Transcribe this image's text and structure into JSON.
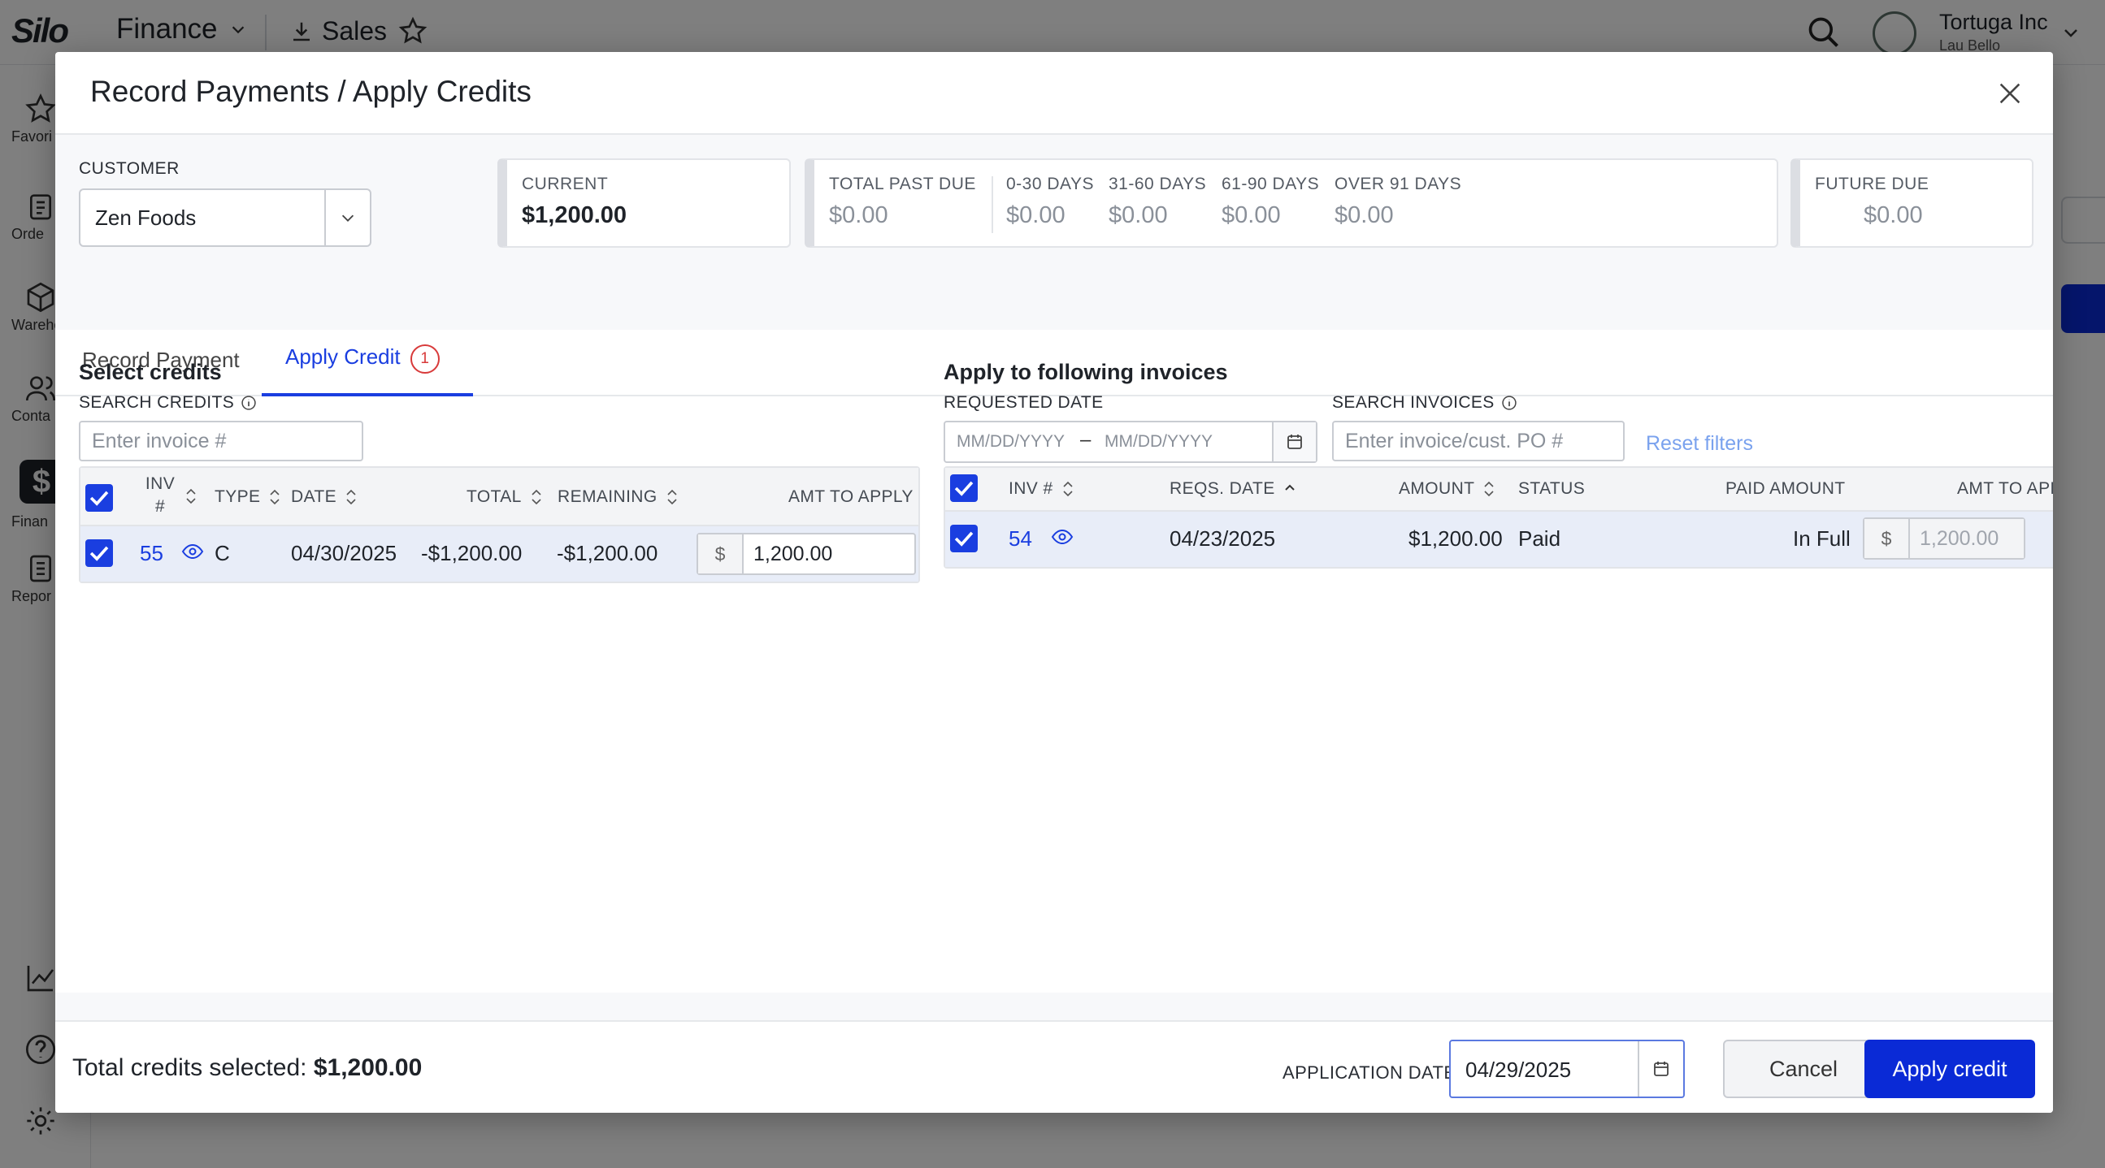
{
  "app": {
    "logo": "Silo",
    "section": "Finance",
    "subsection": "Sales",
    "org": {
      "name": "Tortuga Inc",
      "user": "Lau Bello"
    },
    "nav": [
      {
        "label": "Favori",
        "icon": "star-icon"
      },
      {
        "label": "Orde",
        "icon": "clipboard-icon"
      },
      {
        "label": "Wareho",
        "icon": "box-icon"
      },
      {
        "label": "Conta",
        "icon": "contacts-icon"
      },
      {
        "label": "Finan",
        "icon": "dollar-icon"
      },
      {
        "label": "Repor",
        "icon": "reports-icon"
      }
    ]
  },
  "modal": {
    "title": "Record Payments / Apply Credits",
    "customer": {
      "label": "CUSTOMER",
      "value": "Zen Foods"
    },
    "current": {
      "label": "CURRENT",
      "value": "$1,200.00"
    },
    "past_due": {
      "total": {
        "label": "TOTAL PAST DUE",
        "value": "$0.00"
      },
      "d0_30": {
        "label": "0-30 DAYS",
        "value": "$0.00"
      },
      "d31_60": {
        "label": "31-60 DAYS",
        "value": "$0.00"
      },
      "d61_90": {
        "label": "61-90 DAYS",
        "value": "$0.00"
      },
      "over91": {
        "label": "OVER 91 DAYS",
        "value": "$0.00"
      }
    },
    "future_due": {
      "label": "FUTURE DUE",
      "value": "$0.00"
    },
    "tabs": [
      {
        "label": "Record Payment",
        "active": false
      },
      {
        "label": "Apply Credit",
        "active": true,
        "badge": "1"
      }
    ],
    "credits": {
      "title": "Select credits",
      "search_label": "SEARCH CREDITS",
      "search_placeholder": "Enter invoice #",
      "columns": [
        "INV #",
        "TYPE",
        "DATE",
        "TOTAL",
        "REMAINING",
        "AMT TO APPLY"
      ],
      "rows": [
        {
          "inv": "55",
          "type": "C",
          "date": "04/30/2025",
          "total": "-$1,200.00",
          "remaining": "-$1,200.00",
          "currency": "$",
          "amt": "1,200.00"
        }
      ]
    },
    "invoices": {
      "title": "Apply to following invoices",
      "date_label": "REQUESTED DATE",
      "date_from_placeholder": "MM/DD/YYYY",
      "date_to_placeholder": "MM/DD/YYYY",
      "date_sep": "–",
      "search_label": "SEARCH INVOICES",
      "search_placeholder": "Enter invoice/cust. PO #",
      "reset": "Reset filters",
      "columns": [
        "INV #",
        "REQS. DATE",
        "AMOUNT",
        "STATUS",
        "PAID AMOUNT",
        "AMT TO APPLY"
      ],
      "rows": [
        {
          "inv": "54",
          "date": "04/23/2025",
          "amount": "$1,200.00",
          "status": "Paid",
          "paid": "In Full",
          "currency": "$",
          "amt": "1,200.00"
        }
      ]
    },
    "footer": {
      "total_label": "Total credits selected:",
      "total_value": "$1,200.00",
      "app_date_label": "APPLICATION DATE",
      "app_date": "04/29/2025",
      "cancel": "Cancel",
      "apply": "Apply credit"
    }
  },
  "colors": {
    "accent": "#1a3ee0",
    "primary_button": "#0a2ad6",
    "badge": "#d83a3a"
  }
}
